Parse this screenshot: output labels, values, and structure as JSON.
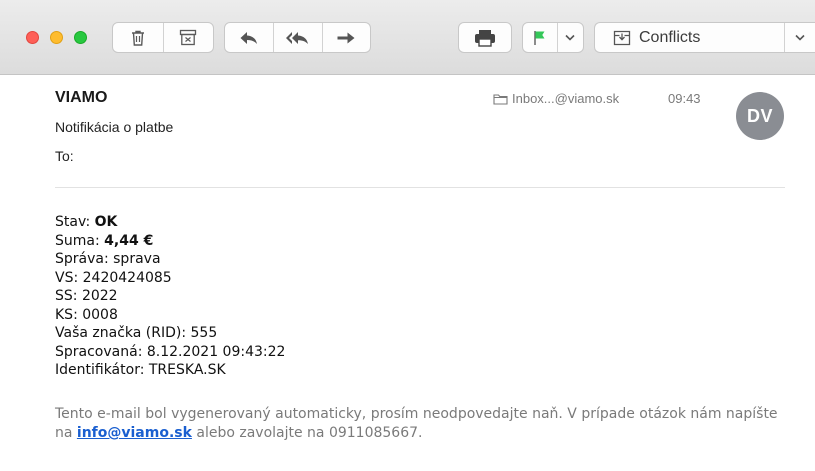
{
  "toolbar": {
    "icons": [
      "trash-icon",
      "archive-icon",
      "reply-icon",
      "reply-all-icon",
      "forward-icon",
      "print-icon",
      "flag-icon",
      "chevron-down-icon",
      "mailbox-icon"
    ],
    "mailbox_label": "Conflicts",
    "flag_color": "#34c759"
  },
  "message": {
    "from": "VIAMO",
    "subject": "Notifikácia o platbe",
    "to_label": "To:",
    "mailbox": "Inbox...@viamo.sk",
    "time": "09:43",
    "avatar_initials": "DV",
    "avatar_color": "#8a8d93"
  },
  "body": {
    "lines": [
      {
        "label": "Stav: ",
        "value": "OK",
        "bold": true
      },
      {
        "label": "Suma: ",
        "value": "4,44 €",
        "bold": true
      },
      {
        "label": "Správa: ",
        "value": "sprava",
        "bold": false
      },
      {
        "label": "VS: ",
        "value": "2420424085",
        "bold": false
      },
      {
        "label": "SS: ",
        "value": "2022",
        "bold": false
      },
      {
        "label": "KS: ",
        "value": "0008",
        "bold": false
      },
      {
        "label": "Vaša značka (RID): ",
        "value": "555",
        "bold": false
      },
      {
        "label": "Spracovaná: ",
        "value": "8.12.2021 09:43:22",
        "bold": false
      },
      {
        "label": "Identifikátor: ",
        "value": "TRESKA.SK",
        "bold": false
      }
    ],
    "footer": {
      "text_before": "Tento e-mail bol vygenerovaný automaticky, prosím neodpovedajte naň. V prípade otázok nám napíšte na ",
      "link": "info@viamo.sk",
      "text_after": " alebo zavolajte na 0911085667."
    }
  }
}
